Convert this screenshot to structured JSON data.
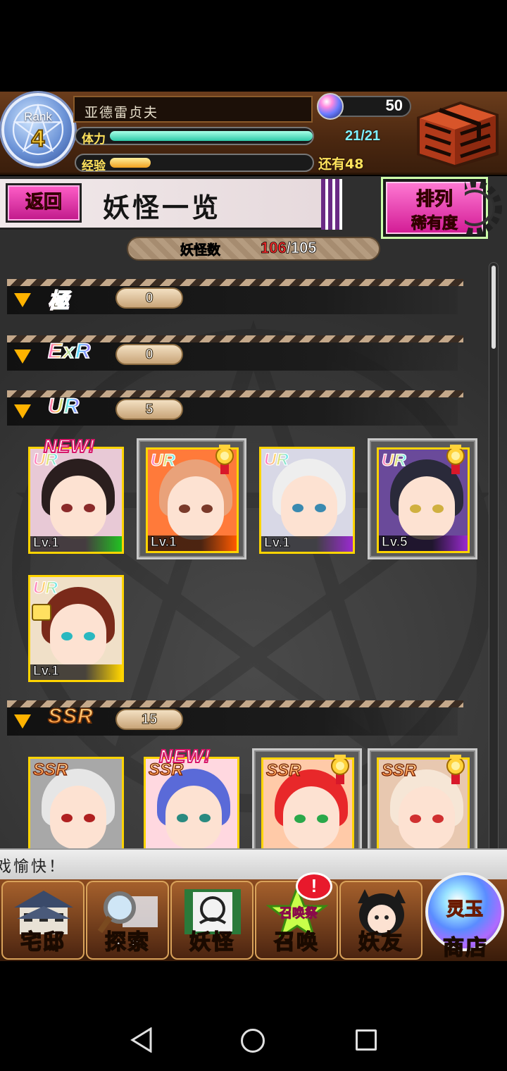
{
  "status": {
    "rank_label": "Rank",
    "rank_value": "4",
    "player_name": "亚德雷贞夫",
    "gems": "50",
    "stamina_label": "体力",
    "stamina_value": "21/21",
    "stamina_fraction": 1.0,
    "exp_label": "经验",
    "exp_remaining": "还有48",
    "exp_fraction": 0.2
  },
  "title_bar": {
    "back_label": "返回",
    "page_title": "妖怪一览",
    "sort_title": "排列",
    "sort_value": "稀有度"
  },
  "collection": {
    "count_label": "妖怪数",
    "count_current": "106",
    "count_max": "/105"
  },
  "categories": [
    {
      "tier": "極",
      "count": "0"
    },
    {
      "tier": "ExR",
      "count": "0"
    },
    {
      "tier": "UR",
      "count": "5"
    },
    {
      "tier": "SSR",
      "count": "15"
    }
  ],
  "ur_cards": [
    {
      "rarity": "UR",
      "level": "Lv.1",
      "is_new": true,
      "new_label": "NEW!",
      "medal": false,
      "hair": "#2a1e1e",
      "eyes": "#8a2a2a",
      "bg": "#e8c9d6",
      "lv_color": "#22c222"
    },
    {
      "rarity": "UR",
      "level": "Lv.1",
      "is_new": false,
      "medal": true,
      "hair": "#e9a27a",
      "eyes": "#7a3a2a",
      "bg": "#ff7a3a",
      "lv_color": "#ff5a00"
    },
    {
      "rarity": "UR",
      "level": "Lv.1",
      "is_new": false,
      "medal": false,
      "hair": "#eeeeee",
      "eyes": "#3a8ab0",
      "bg": "#d8d8e6",
      "lv_color": "#9a2ad0"
    },
    {
      "rarity": "UR",
      "level": "Lv.5",
      "is_new": false,
      "medal": true,
      "hair": "#2a2a3a",
      "eyes": "#d0b040",
      "bg": "#6a4a9a",
      "lv_color": "#9a2ad0"
    },
    {
      "rarity": "UR",
      "level": "Lv.1",
      "is_new": false,
      "medal": false,
      "locked": true,
      "hair": "#7a2a1a",
      "eyes": "#2ab8c0",
      "bg": "#f0e0c8",
      "lv_color": "#ffd400"
    }
  ],
  "ssr_cards": [
    {
      "rarity": "SSR",
      "is_new": false,
      "medal": false,
      "hair": "#e6e6e6",
      "eyes": "#b02020",
      "bg": "#a8a8a8"
    },
    {
      "rarity": "SSR",
      "is_new": true,
      "new_label": "NEW!",
      "medal": false,
      "hair": "#5a6ad8",
      "eyes": "#2a8a80",
      "bg": "#ffd8e0"
    },
    {
      "rarity": "SSR",
      "is_new": false,
      "medal": true,
      "hair": "#e8282a",
      "eyes": "#2aa84a",
      "bg": "#ffcaa8"
    },
    {
      "rarity": "SSR",
      "is_new": false,
      "medal": true,
      "hair": "#f6e6d6",
      "eyes": "#d03030",
      "bg": "#e8c8b0"
    }
  ],
  "ticker": "戏愉快！",
  "nav": [
    {
      "label": "宅邸",
      "icon": "mansion-icon"
    },
    {
      "label": "探索",
      "icon": "magnifier-icon"
    },
    {
      "label": "妖怪",
      "icon": "scroll-icon"
    },
    {
      "label": "召唤",
      "icon": "summon-icon",
      "badge": "!",
      "festival": "召唤祭"
    },
    {
      "label": "妖友",
      "icon": "friends-icon"
    },
    {
      "label": "商店",
      "icon": "shop-orb-icon",
      "orb_text": "灵玉"
    }
  ],
  "colors": {
    "accent": "#e0339e",
    "header_brown": "#4a2710",
    "gold": "#ffd400"
  }
}
